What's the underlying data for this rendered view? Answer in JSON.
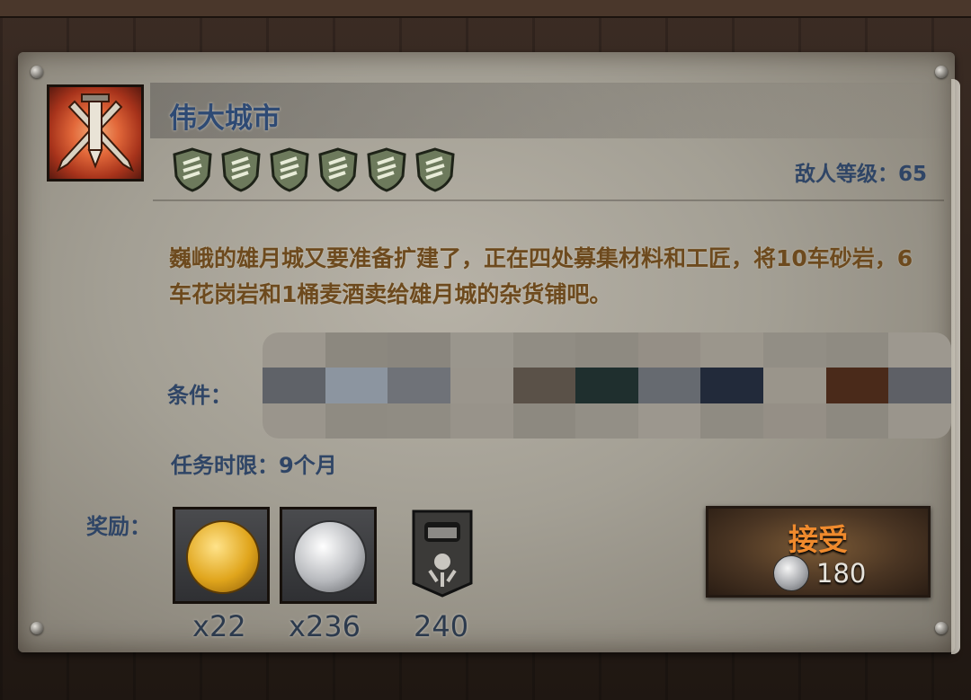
{
  "quest": {
    "title": "伟大城市",
    "icon": "crossed-swords-icon",
    "difficulty_shields": 6,
    "enemy_level_label": "敌人等级：65",
    "description": "巍峨的雄月城又要准备扩建了，正在四处募集材料和工匠，将10车砂岩，6车花岗岩和1桶麦酒卖给雄月城的杂货铺吧。",
    "conditions_label": "条件：",
    "time_limit_label": "任务时限：9个月",
    "rewards_label": "奖励：",
    "rewards": [
      {
        "icon": "gold-coin-icon",
        "amount": "x22"
      },
      {
        "icon": "silver-coin-icon",
        "amount": "x236"
      },
      {
        "icon": "reputation-banner-icon",
        "amount": "240"
      }
    ],
    "accept": {
      "label": "接受",
      "cost_icon": "silver-coin-icon",
      "cost": "180"
    }
  },
  "colors": {
    "title": "#2e4a74",
    "description": "#6d4a1e",
    "accept_text": "#ef8a2d"
  }
}
